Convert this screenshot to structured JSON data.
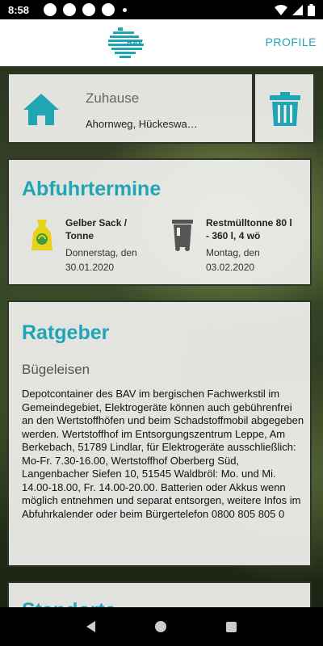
{
  "status_bar": {
    "time": "8:58"
  },
  "header": {
    "logo_text": "BAV",
    "profile_label": "PROFILE"
  },
  "address": {
    "title": "Zuhause",
    "street": "Ahornweg, Hückeswa…"
  },
  "abfuhr": {
    "title": "Abfuhrtermine",
    "items": [
      {
        "type": "Gelber Sack / Tonne",
        "date": "Donnerstag, den 30.01.2020",
        "icon": "yellow-bag-icon",
        "color": "#e8d31a"
      },
      {
        "type": "Restmülltonne 80 l - 360 l, 4 wö",
        "date": "Montag, den 03.02.2020",
        "icon": "grey-bin-icon",
        "color": "#555555"
      }
    ]
  },
  "ratgeber": {
    "title": "Ratgeber",
    "subtitle": "Bügeleisen",
    "body": "Depotcontainer des BAV im bergischen Fachwerkstil im Gemeindegebiet, Elektrogeräte können auch gebührenfrei an den Wertstoffhöfen und beim Schadstoffmobil abgegeben werden. Wertstoffhof im Entsorgungszentrum Leppe, Am Berkebach, 51789 Lindlar, für Elektrogeräte ausschließlich: Mo-Fr. 7.30-16.00, Wertstoffhof Oberberg Süd, Langenbacher Siefen 10, 51545 Waldbröl: Mo. und Mi. 14.00-18.00, Fr. 14.00-20.00. Batterien oder Akkus wenn möglich entnehmen und separat entsorgen, weitere Infos im Abfuhrkalender oder beim Bürgertelefon 0800 805 805 0"
  },
  "standorte": {
    "title": "Standorte"
  },
  "colors": {
    "accent": "#1fa5b3"
  }
}
